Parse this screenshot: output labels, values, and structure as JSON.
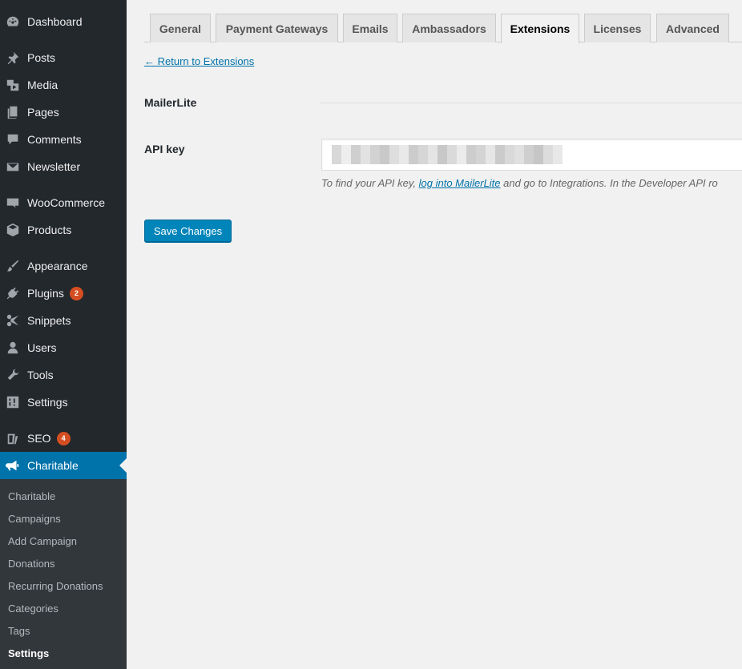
{
  "sidebar": {
    "items": [
      {
        "label": "Dashboard",
        "icon": "dashboard-icon"
      },
      {
        "label": "Posts",
        "icon": "pin-icon"
      },
      {
        "label": "Media",
        "icon": "media-icon"
      },
      {
        "label": "Pages",
        "icon": "pages-icon"
      },
      {
        "label": "Comments",
        "icon": "comment-icon"
      },
      {
        "label": "Newsletter",
        "icon": "envelope-icon"
      },
      {
        "label": "WooCommerce",
        "icon": "woo-icon"
      },
      {
        "label": "Products",
        "icon": "box-icon"
      },
      {
        "label": "Appearance",
        "icon": "brush-icon"
      },
      {
        "label": "Plugins",
        "icon": "plug-icon",
        "badge": "2"
      },
      {
        "label": "Snippets",
        "icon": "scissors-icon"
      },
      {
        "label": "Users",
        "icon": "user-icon"
      },
      {
        "label": "Tools",
        "icon": "wrench-icon"
      },
      {
        "label": "Settings",
        "icon": "sliders-icon"
      },
      {
        "label": "SEO",
        "icon": "yoast-icon",
        "badge": "4"
      },
      {
        "label": "Charitable",
        "icon": "megaphone-icon",
        "active": true
      }
    ],
    "submenu": [
      "Charitable",
      "Campaigns",
      "Add Campaign",
      "Donations",
      "Recurring Donations",
      "Categories",
      "Tags",
      "Settings"
    ],
    "submenu_current": "Settings"
  },
  "tabs": [
    "General",
    "Payment Gateways",
    "Emails",
    "Ambassadors",
    "Extensions",
    "Licenses",
    "Advanced"
  ],
  "active_tab": "Extensions",
  "back_link": "← Return to Extensions",
  "section": {
    "title": "MailerLite"
  },
  "api_key": {
    "label": "API key",
    "help_before": "To find your API key, ",
    "help_link": "log into MailerLite",
    "help_after": " and go to Integrations. In the Developer API ro"
  },
  "save_button": "Save Changes",
  "colors": {
    "accent": "#0073aa",
    "sidebar": "#23282d",
    "badge": "#d54e21"
  }
}
